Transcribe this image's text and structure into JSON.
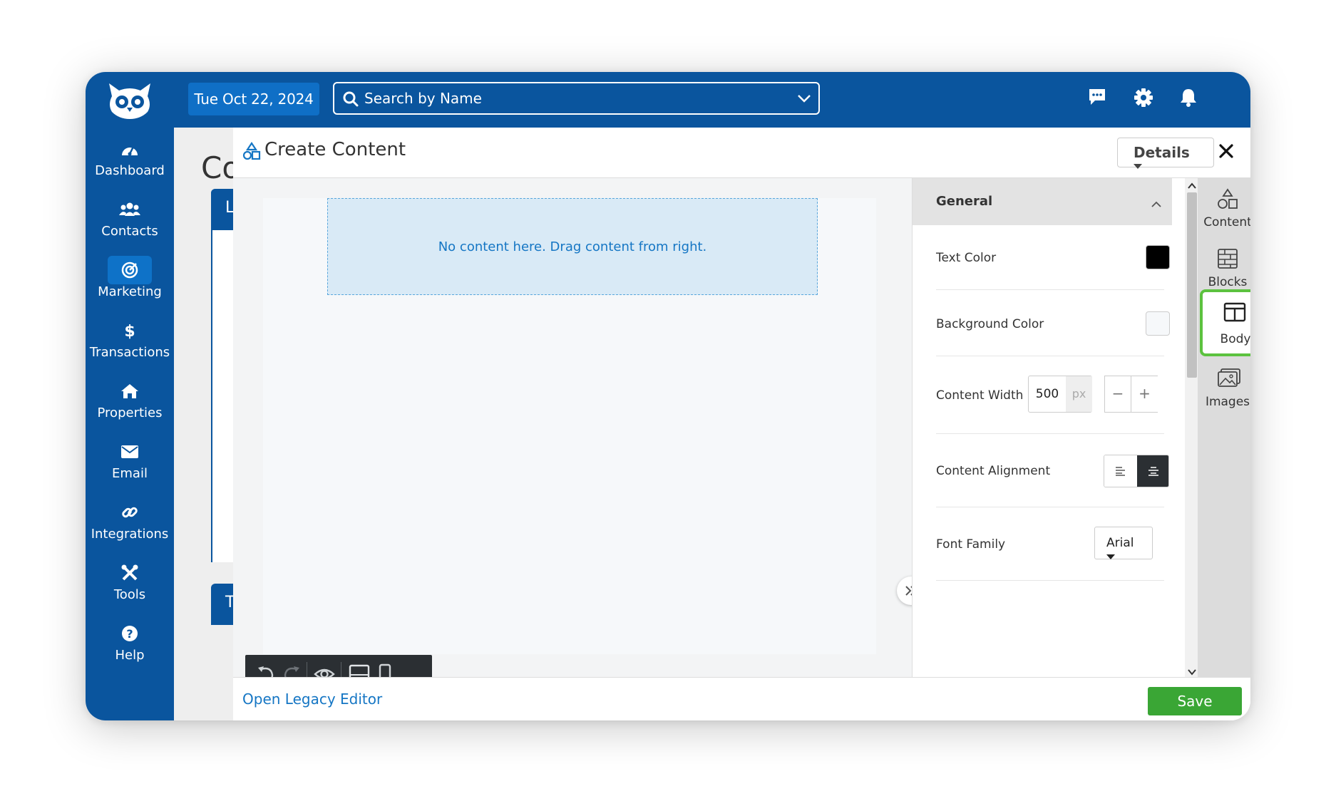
{
  "app": {
    "date": "Tue Oct 22, 2024",
    "search_placeholder": "Search by Name"
  },
  "sidebar": {
    "items": [
      {
        "label": "Dashboard",
        "icon": "dashboard-icon"
      },
      {
        "label": "Contacts",
        "icon": "contacts-icon"
      },
      {
        "label": "Marketing",
        "icon": "marketing-icon",
        "active": true
      },
      {
        "label": "Transactions",
        "icon": "dollar-icon"
      },
      {
        "label": "Properties",
        "icon": "home-icon"
      },
      {
        "label": "Email",
        "icon": "email-icon"
      },
      {
        "label": "Integrations",
        "icon": "link-icon"
      },
      {
        "label": "Tools",
        "icon": "tools-icon"
      },
      {
        "label": "Help",
        "icon": "help-icon"
      }
    ]
  },
  "background_page": {
    "title_fragment": "Co",
    "card1_letter": "L",
    "card2_letter": "T"
  },
  "modal": {
    "title": "Create Content",
    "details_label": "Details",
    "dropzone_text": "No content here. Drag content from right.",
    "legacy_link": "Open Legacy Editor",
    "save_label": "Save"
  },
  "properties": {
    "section_title": "General",
    "text_color_label": "Text Color",
    "text_color_value": "#000000",
    "background_color_label": "Background Color",
    "background_color_value": "#f6f8fa",
    "content_width_label": "Content Width",
    "content_width_value": "500",
    "content_width_unit": "px",
    "content_alignment_label": "Content Alignment",
    "font_family_label": "Font Family",
    "font_family_value": "Arial"
  },
  "tooltabs": [
    {
      "label": "Content",
      "icon": "shapes-icon"
    },
    {
      "label": "Blocks",
      "icon": "blocks-icon"
    },
    {
      "label": "Body",
      "icon": "body-layout-icon",
      "selected": true
    },
    {
      "label": "Images",
      "icon": "images-icon"
    }
  ],
  "colors": {
    "brand_blue": "#0a559e",
    "date_pill": "#0f6fc6",
    "link_blue": "#1576c4",
    "save_green": "#3aa635",
    "highlight_green": "#5cc23f",
    "dropzone_bg": "#d9eaf6"
  }
}
